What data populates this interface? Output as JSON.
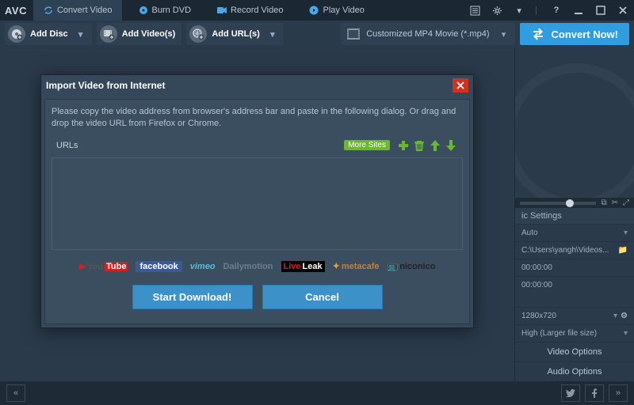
{
  "app": {
    "logo": "AVC"
  },
  "tabs": [
    {
      "label": "Convert Video"
    },
    {
      "label": "Burn DVD"
    },
    {
      "label": "Record Video"
    },
    {
      "label": "Play Video"
    }
  ],
  "toolbar": {
    "add_disc": "Add Disc",
    "add_videos": "Add Video(s)",
    "add_urls": "Add URL(s)",
    "format": "Customized MP4 Movie (*.mp4)",
    "convert": "Convert Now!"
  },
  "dialog": {
    "title": "Import Video from Internet",
    "message": "Please copy the video address from browser's address bar and paste in the following dialog. Or drag and drop the video URL from Firefox or Chrome.",
    "urls_label": "URLs",
    "more_sites": "More Sites",
    "start": "Start Download!",
    "cancel": "Cancel",
    "sites": [
      "YouTube",
      "facebook",
      "vimeo",
      "Dailymotion",
      "LiveLeak",
      "metacafe",
      "niconico"
    ]
  },
  "settings": {
    "header": "ic Settings",
    "rows": [
      "Auto",
      "C:\\Users\\yangh\\Videos...",
      "00:00:00",
      "00:00:00"
    ],
    "res": "1280x720",
    "quality": "High (Larger file size)",
    "video_options": "Video Options",
    "audio_options": "Audio Options"
  }
}
